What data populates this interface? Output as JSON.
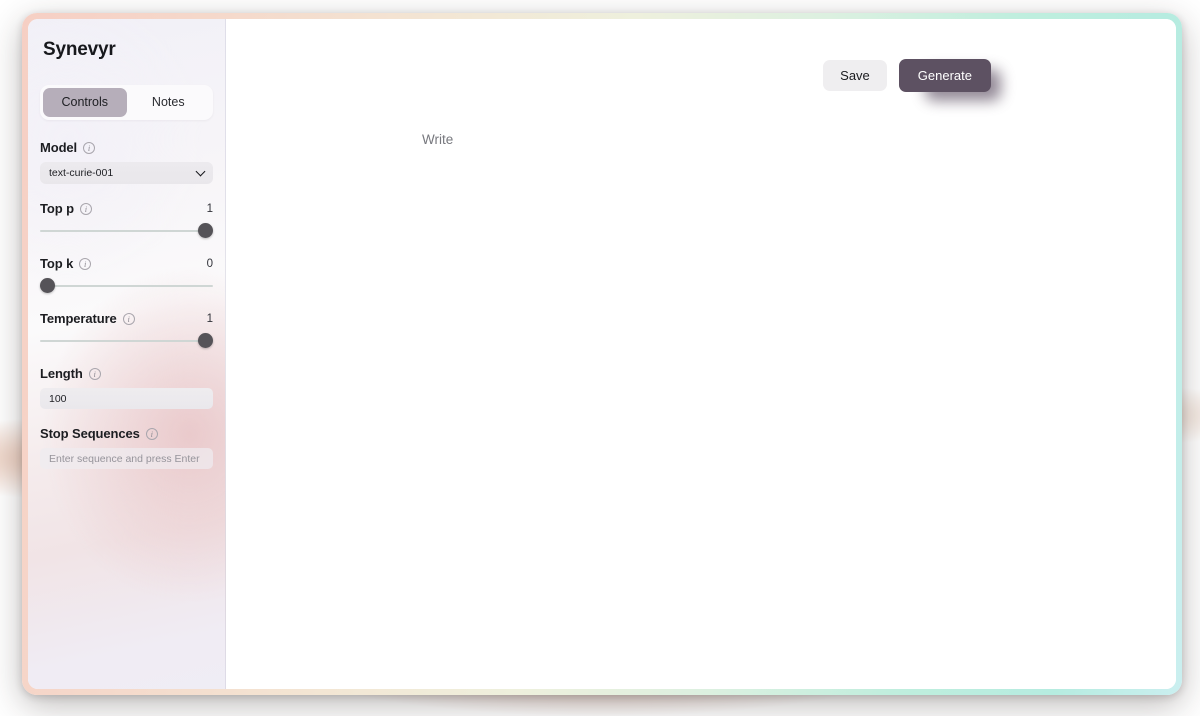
{
  "window": {
    "title": "Synevyr",
    "left_resize_handle": "resize-dots",
    "right_scrollbar": "vertical-scrollbar"
  },
  "sidebar": {
    "tabs": [
      {
        "label": "Controls",
        "active": true
      },
      {
        "label": "Notes",
        "active": false
      }
    ],
    "fields": {
      "model": {
        "label": "Model",
        "info_icon": "info-icon",
        "value": "text-curie-001",
        "chevron_icon": "chevron-down-icon"
      },
      "top_p": {
        "label": "Top p",
        "info_icon": "info-icon",
        "value": "1",
        "percent": 100
      },
      "top_k": {
        "label": "Top k",
        "info_icon": "info-icon",
        "value": "0",
        "percent": 0
      },
      "temperature": {
        "label": "Temperature",
        "info_icon": "info-icon",
        "value": "1",
        "percent": 100
      },
      "length": {
        "label": "Length",
        "info_icon": "info-icon",
        "value": "100"
      },
      "stop_sequences": {
        "label": "Stop Sequences",
        "info_icon": "info-icon",
        "value": "",
        "placeholder": "Enter sequence and press Enter"
      }
    }
  },
  "main": {
    "editor_placeholder": "Write",
    "toolbar": {
      "save_label": "Save",
      "generate_label": "Generate"
    }
  },
  "colors": {
    "accent": "#5d5162",
    "tab_active": "#b6aeba",
    "slider_thumb": "#555358",
    "slider_track": "#cfd6d4",
    "border_gradient_start": "#f6cfc4",
    "border_gradient_end": "#b6ece0"
  }
}
